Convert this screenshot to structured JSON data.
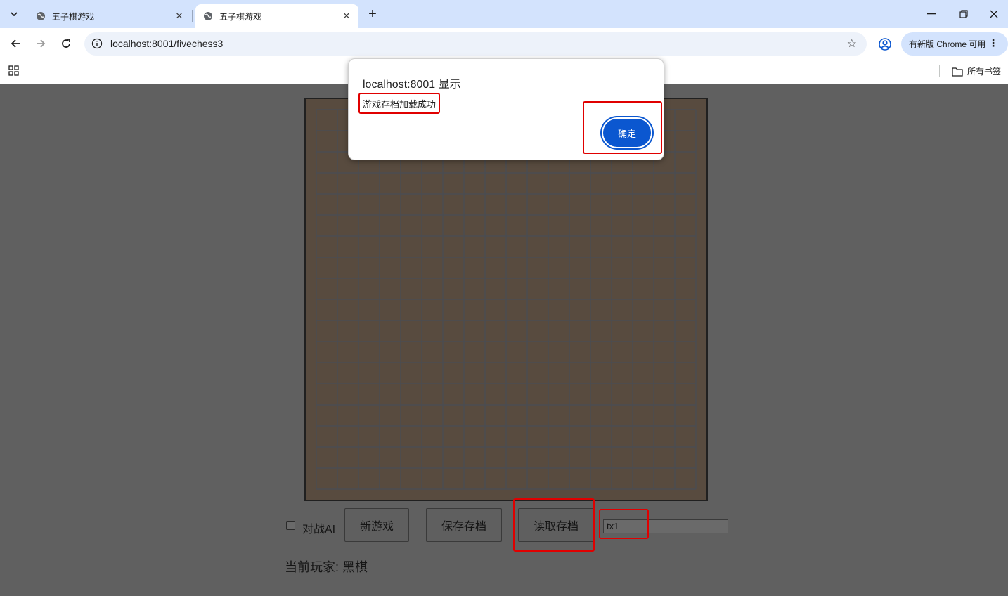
{
  "browser": {
    "tabs": [
      {
        "title": "五子棋游戏",
        "active": false
      },
      {
        "title": "五子棋游戏",
        "active": true
      }
    ],
    "address": "localhost:8001/fivechess3",
    "update_chip": "有新版 Chrome 可用",
    "all_bookmarks": "所有书签"
  },
  "game": {
    "grid_lines": 19,
    "board_color": "#584b3f",
    "ai_label": "对战AI",
    "ai_checked": false,
    "buttons": {
      "new_game": "新游戏",
      "save_game": "保存存档",
      "load_game": "读取存档"
    },
    "save_name_value": "tx1",
    "current_player": "当前玩家: 黑棋"
  },
  "dialog": {
    "title": "localhost:8001 显示",
    "message": "游戏存档加载成功",
    "ok_label": "确定"
  },
  "colors": {
    "accent": "#0b57d0",
    "highlight": "#e00000",
    "tabstrip": "#d3e3fd"
  }
}
